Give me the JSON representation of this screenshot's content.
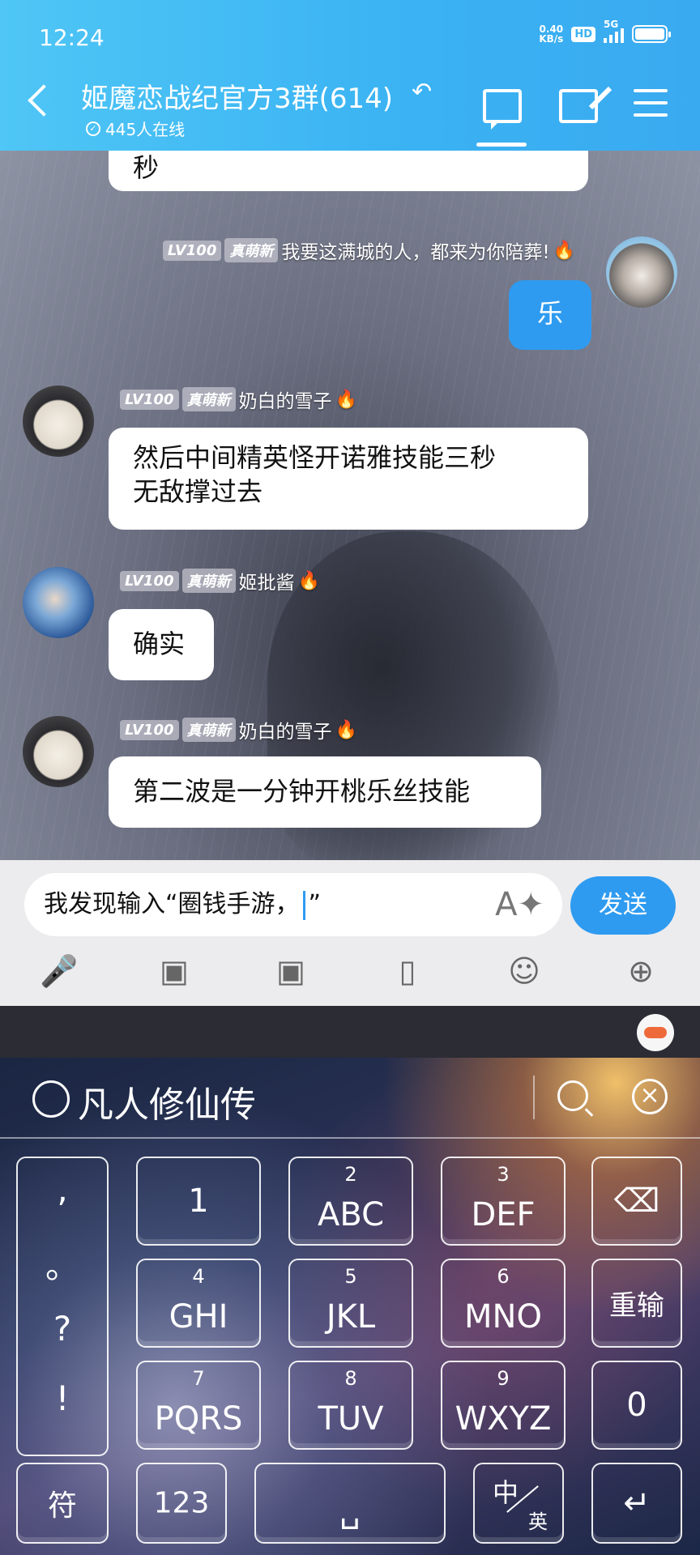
{
  "status_bar": {
    "time": "12:24",
    "net_speed_value": "0.40",
    "net_speed_unit": "KB/s",
    "hd_label": "HD",
    "network": "5G"
  },
  "header": {
    "title": "姬魔恋战纪官方3群(614)",
    "online": "445人在线",
    "ear_icon": "ear-icon"
  },
  "messages": [
    {
      "sender": "",
      "text": "秒"
    },
    {
      "level": "LV100",
      "badge": "真萌新",
      "sender": "我要这满城的人，都来为你陪葬!",
      "text": "乐",
      "mine": true
    },
    {
      "level": "LV100",
      "badge": "真萌新",
      "sender": "奶白的雪子",
      "text_line1": "然后中间精英怪开诺雅技能三秒",
      "text_line2": "无敌撑过去"
    },
    {
      "level": "LV100",
      "badge": "真萌新",
      "sender": "姬批酱",
      "text": "确实"
    },
    {
      "level": "LV100",
      "badge": "真萌新",
      "sender": "奶白的雪子",
      "text": "第二波是一分钟开桃乐丝技能"
    }
  ],
  "input": {
    "value_before_caret": "我发现输入“圈钱手游，",
    "value_after_caret": "”",
    "send_label": "发送"
  },
  "keyboard": {
    "candidate": "凡人修仙传",
    "punct": [
      ",",
      "。",
      "?",
      "!"
    ],
    "keys": [
      {
        "sub": "",
        "main": "1"
      },
      {
        "sub": "2",
        "main": "ABC"
      },
      {
        "sub": "3",
        "main": "DEF"
      },
      {
        "sub": "4",
        "main": "GHI"
      },
      {
        "sub": "5",
        "main": "JKL"
      },
      {
        "sub": "6",
        "main": "MNO"
      },
      {
        "sub": "7",
        "main": "PQRS"
      },
      {
        "sub": "8",
        "main": "TUV"
      },
      {
        "sub": "9",
        "main": "WXYZ"
      }
    ],
    "reenter": "重输",
    "zero": "0",
    "symbols": "符",
    "numbers": "123",
    "lang_zh": "中",
    "lang_en": "英",
    "backspace_icon": "backspace-icon",
    "enter_icon": "enter-icon",
    "space_icon": "space-icon"
  },
  "colors": {
    "header_bg": "#3ab2f3",
    "send_button": "#2f9bf0",
    "my_bubble": "#2f9bf0"
  }
}
